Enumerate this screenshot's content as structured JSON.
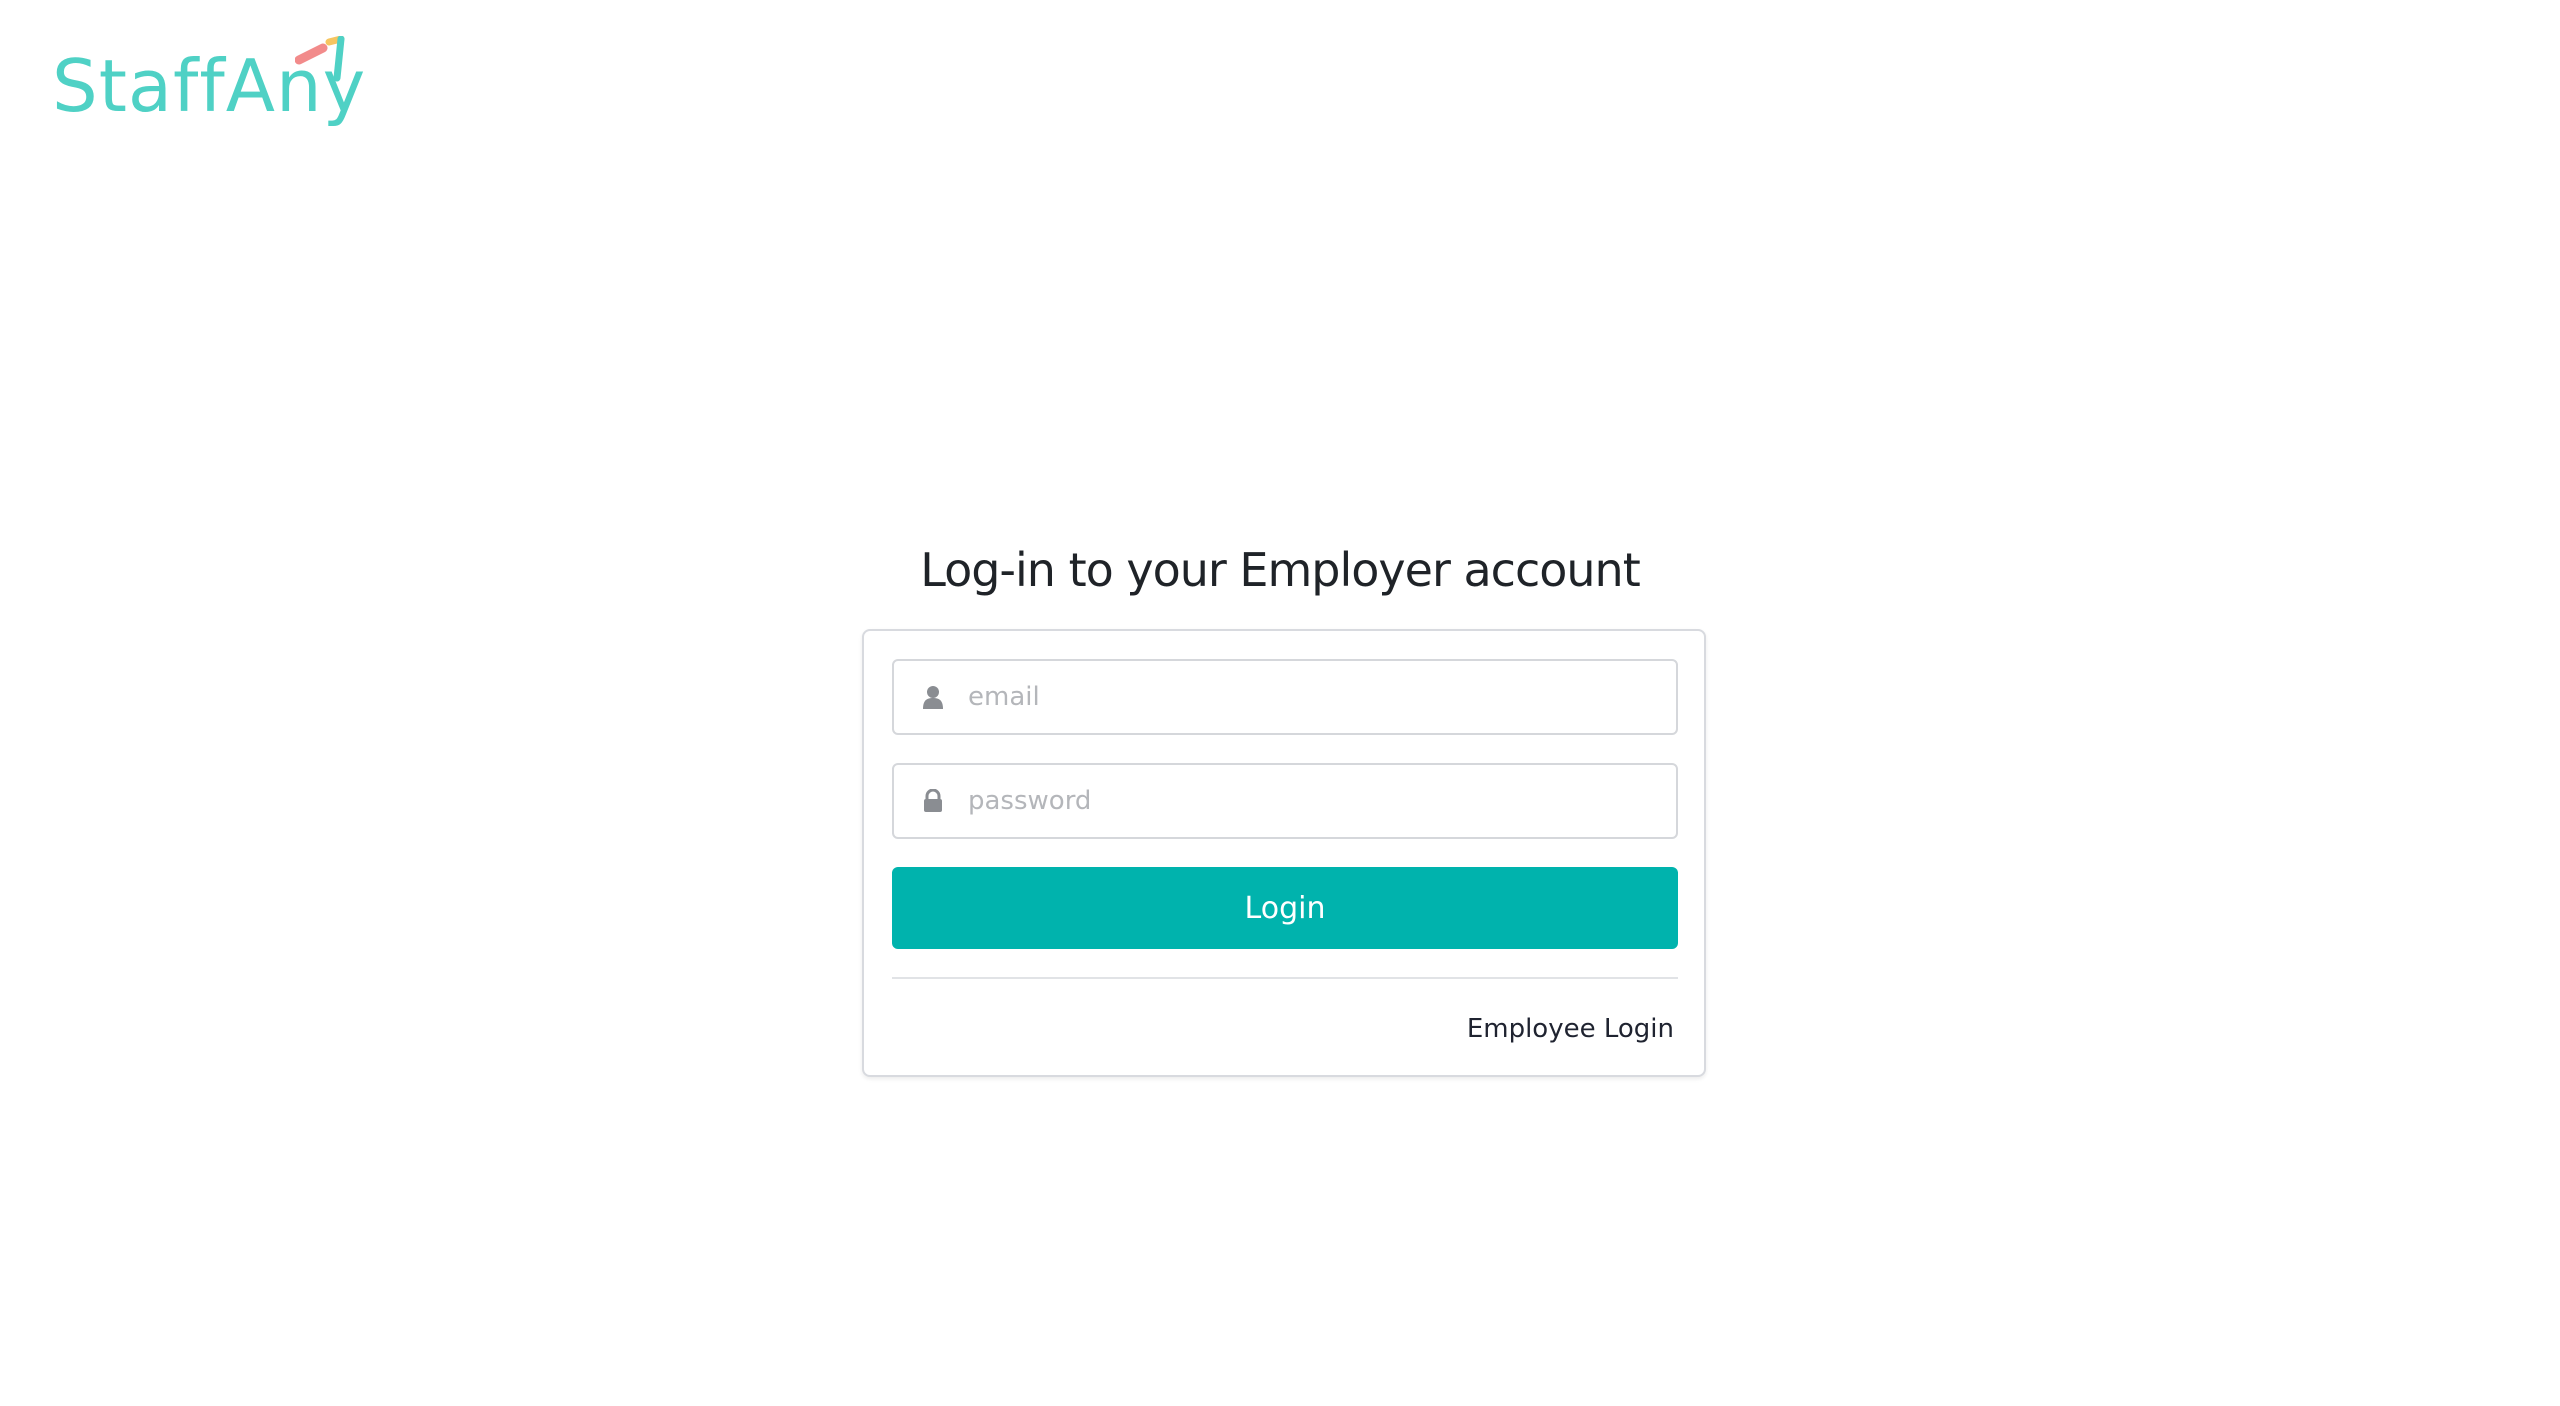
{
  "brand": {
    "name": "StaffAny",
    "primary_color": "#00b3ad",
    "logo_color": "#4fd1c5"
  },
  "login": {
    "title": "Log-in to your Employer account",
    "email": {
      "placeholder": "email",
      "icon": "user-icon"
    },
    "password": {
      "placeholder": "password",
      "icon": "lock-icon"
    },
    "submit_label": "Login",
    "employee_login_label": "Employee Login"
  }
}
